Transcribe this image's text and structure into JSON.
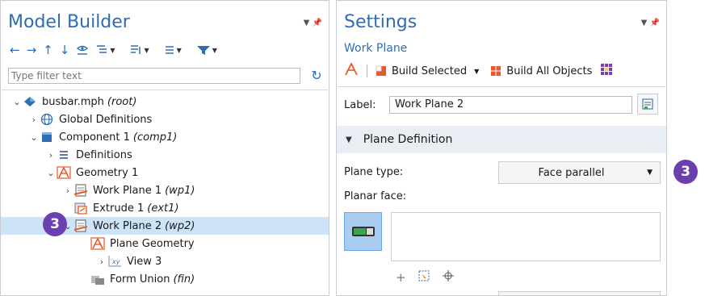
{
  "model_builder": {
    "title": "Model Builder",
    "filter_placeholder": "Type filter text",
    "tree": [
      {
        "label": "busbar.mph",
        "tag": "(root)",
        "icon": "root-model-icon",
        "expander": "expanded"
      },
      {
        "label": "Global Definitions",
        "tag": "",
        "icon": "globe-icon",
        "expander": "collapsed"
      },
      {
        "label": "Component 1",
        "tag": "(comp1)",
        "icon": "component-icon",
        "expander": "expanded"
      },
      {
        "label": "Definitions",
        "tag": "",
        "icon": "definitions-icon",
        "expander": "collapsed"
      },
      {
        "label": "Geometry 1",
        "tag": "",
        "icon": "geometry-icon",
        "expander": "expanded"
      },
      {
        "label": "Work Plane 1",
        "tag": "(wp1)",
        "icon": "work-plane-icon",
        "expander": "collapsed"
      },
      {
        "label": "Extrude 1",
        "tag": "(ext1)",
        "icon": "extrude-icon",
        "expander": "none"
      },
      {
        "label": "Work Plane 2",
        "tag": "(wp2)",
        "icon": "work-plane-icon",
        "expander": "expanded",
        "selected": true
      },
      {
        "label": "Plane Geometry",
        "tag": "",
        "icon": "plane-geometry-icon",
        "expander": "none"
      },
      {
        "label": "View 3",
        "tag": "",
        "icon": "view-xy-icon",
        "expander": "collapsed"
      },
      {
        "label": "Form Union",
        "tag": "(fin)",
        "icon": "form-union-icon",
        "expander": "none"
      }
    ],
    "badge": "3"
  },
  "settings": {
    "title": "Settings",
    "subtitle": "Work Plane",
    "toolbar": {
      "build_selected": "Build Selected",
      "build_all": "Build All Objects"
    },
    "label_key": "Label:",
    "label_value": "Work Plane 2",
    "section": "Plane Definition",
    "plane_type_key": "Plane type:",
    "plane_type_value": "Face parallel",
    "planar_face_key": "Planar face:",
    "badge": "3"
  },
  "colors": {
    "accent": "#2d6db3",
    "badge": "#6b3fb0",
    "selection": "#cde3f7",
    "geometry_orange": "#e8582c"
  }
}
